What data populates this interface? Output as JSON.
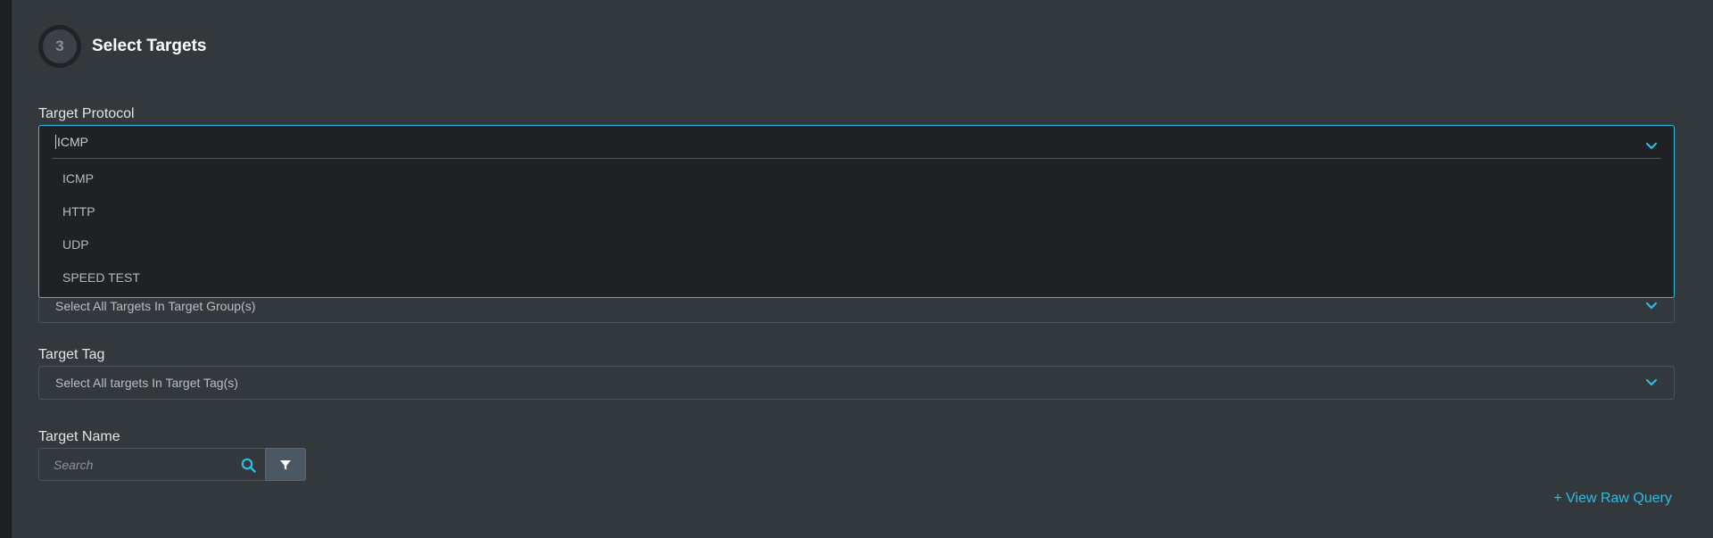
{
  "step": {
    "number": "3",
    "title": "Select Targets"
  },
  "target_protocol": {
    "label": "Target Protocol",
    "value": "ICMP",
    "options": [
      "ICMP",
      "HTTP",
      "UDP",
      "SPEED TEST"
    ]
  },
  "target_group": {
    "placeholder": "Select All Targets In Target Group(s)"
  },
  "target_tag": {
    "label": "Target Tag",
    "placeholder": "Select All targets In Target Tag(s)"
  },
  "target_name": {
    "label": "Target Name",
    "search_placeholder": "Search"
  },
  "raw_query_link": "+ View Raw Query",
  "colors": {
    "accent": "#2bbde2",
    "panel": "#33383c",
    "dropdown_bg": "#1f2124",
    "filter_button": "#4b5663"
  },
  "icons": [
    "chevron-down-icon",
    "search-icon",
    "filter-icon"
  ]
}
